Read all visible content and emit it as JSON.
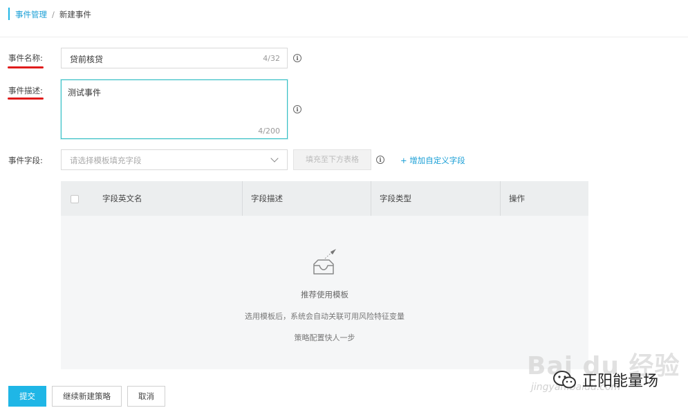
{
  "breadcrumb": {
    "parent": "事件管理",
    "separator": "/",
    "current": "新建事件"
  },
  "form": {
    "name": {
      "label": "事件名称:",
      "value": "贷前核贷",
      "count": "4/32"
    },
    "description": {
      "label": "事件描述:",
      "value": "测试事件",
      "count": "4/200"
    },
    "fields": {
      "label": "事件字段:",
      "select_placeholder": "请选择模板填充字段",
      "fill_button": "填充至下方表格",
      "add_link": "+ 增加自定义字段"
    }
  },
  "table": {
    "columns": [
      "字段英文名",
      "字段描述",
      "字段类型",
      "操作"
    ],
    "empty": {
      "title": "推荐使用模板",
      "line1": "选用模板后，系统会自动关联可用风险特征变量",
      "line2": "策略配置快人一步"
    }
  },
  "actions": {
    "submit": "提交",
    "continue": "继续新建策略",
    "cancel": "取消"
  },
  "watermark": {
    "baidu": "Bai du 经验",
    "brand": "正阳能量场",
    "url": "jingyan.baidu.com"
  },
  "colors": {
    "accent": "#1fb6e6",
    "link": "#1a9fd6",
    "underline": "#e01b1b",
    "focus_border": "#37c0c6"
  }
}
